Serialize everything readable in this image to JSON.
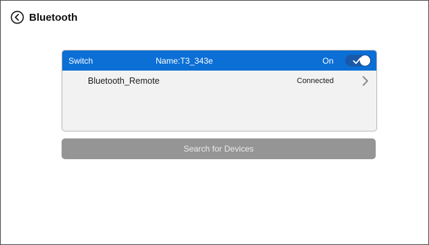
{
  "header": {
    "title": "Bluetooth",
    "back_icon": "back-circle-icon"
  },
  "switch_bar": {
    "label": "Switch",
    "device_name": "Name:T3_343e",
    "state": "On",
    "toggle_on": true,
    "accent_color": "#0b6fd6"
  },
  "devices": [
    {
      "name": "Bluetooth_Remote",
      "status": "Connected",
      "icon": "chevron-right-icon"
    }
  ],
  "search": {
    "label": "Search for Devices"
  }
}
